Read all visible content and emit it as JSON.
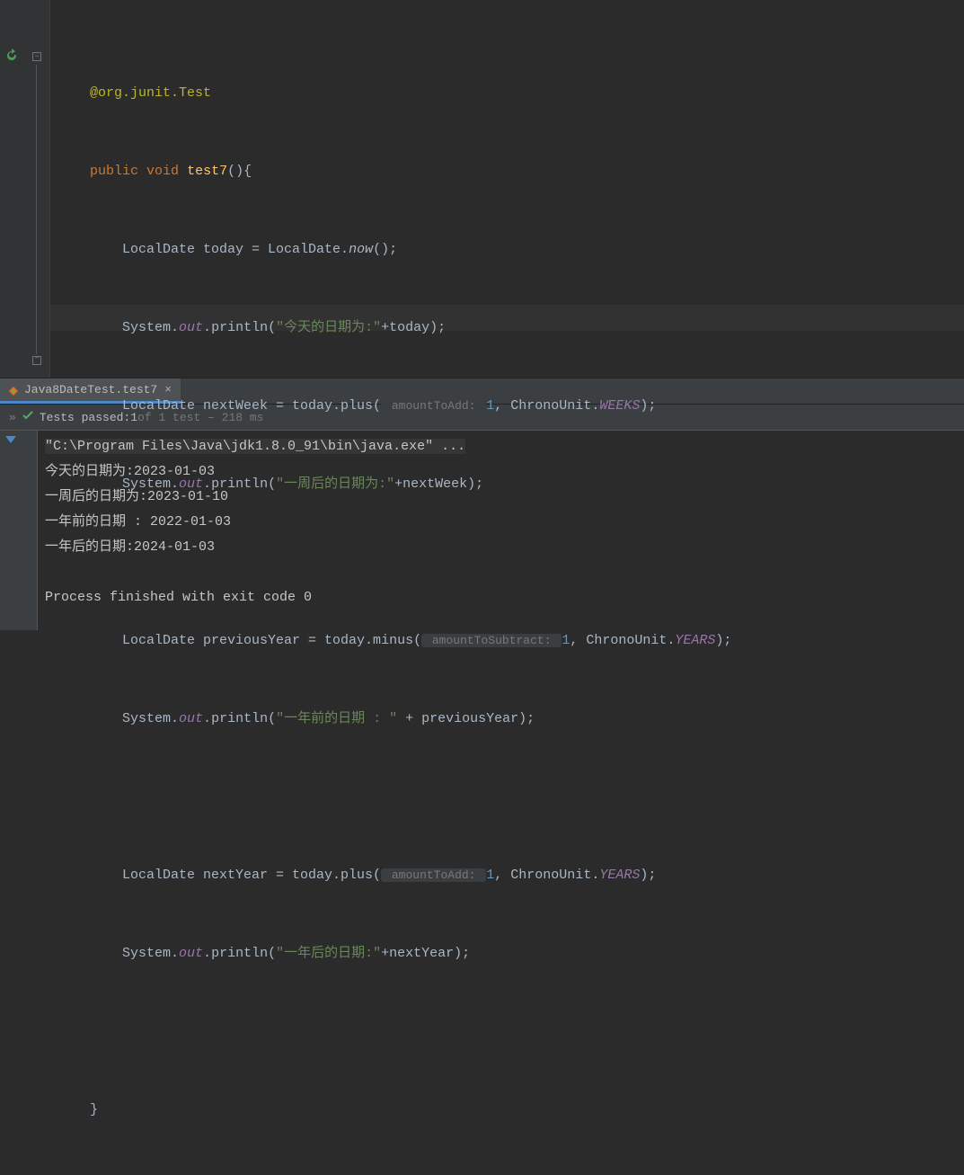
{
  "code": {
    "annotation": "@org.junit.Test",
    "public": "public",
    "void": "void",
    "method": "test7",
    "today_decl": "LocalDate today = LocalDate.",
    "now": "now",
    "println": "println",
    "sys": "System.",
    "out": "out",
    "str_today": "\"今天的日期为:\"",
    "plus_today": "+today);",
    "nextweek_decl": "LocalDate nextWeek = today.plus(",
    "hint_add": " amountToAdd: ",
    "one": "1",
    "chrono_weeks_pre": ", ChronoUnit.",
    "WEEKS": "WEEKS",
    "str_nextweek": "\"一周后的日期为:\"",
    "plus_nextweek": "+nextWeek);",
    "prevyear_decl": "LocalDate previousYear = today.minus(",
    "hint_sub": " amountToSubtract: ",
    "YEARS": "YEARS",
    "str_prevyear": "\"一年前的日期 : \"",
    "plus_prevyear": " + previousYear);",
    "nextyear_decl": "LocalDate nextYear = today.plus(",
    "str_nextyear": "\"一年后的日期:\"",
    "plus_nextyear": "+nextYear);"
  },
  "tab": {
    "label": "Java8DateTest.test7",
    "close": "×"
  },
  "toolbar": {
    "chevrons": "»",
    "passed_prefix": "Tests passed: ",
    "passed_count": "1",
    "of": " of 1 test – 218 ms"
  },
  "console": {
    "cmd": "\"C:\\Program Files\\Java\\jdk1.8.0_91\\bin\\java.exe\" ...",
    "l1": "今天的日期为:2023-01-03",
    "l2": "一周后的日期为:2023-01-10",
    "l3": "一年前的日期 : 2022-01-03",
    "l4": "一年后的日期:2024-01-03",
    "exit": "Process finished with exit code 0"
  }
}
